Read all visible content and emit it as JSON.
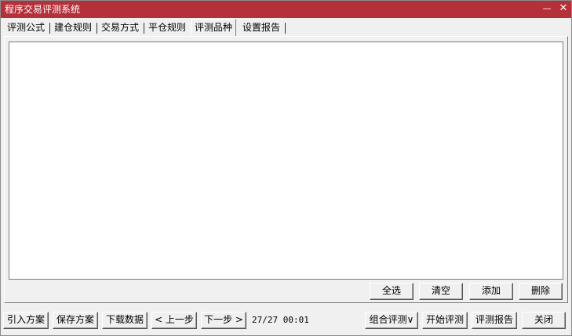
{
  "window": {
    "title": "程序交易评测系统",
    "minimize_glyph": "—",
    "close_glyph": "✕"
  },
  "tabs": [
    {
      "label": "评测公式"
    },
    {
      "label": "建仓规则"
    },
    {
      "label": "交易方式"
    },
    {
      "label": "平仓规则"
    },
    {
      "label": "评测品种",
      "active": true
    },
    {
      "label": "设置报告"
    }
  ],
  "panel_buttons": {
    "select_all": "全选",
    "clear": "清空",
    "add": "添加",
    "delete": "删除"
  },
  "footer": {
    "import_plan": "引入方案",
    "save_plan": "保存方案",
    "download_data": "下载数据",
    "prev_step": "< 上一步",
    "next_step": "下一步 >",
    "status": "27/27 00:01",
    "combo_eval": "组合评测∨",
    "start_eval": "开始评测",
    "eval_report": "评测报告",
    "close": "关闭"
  }
}
